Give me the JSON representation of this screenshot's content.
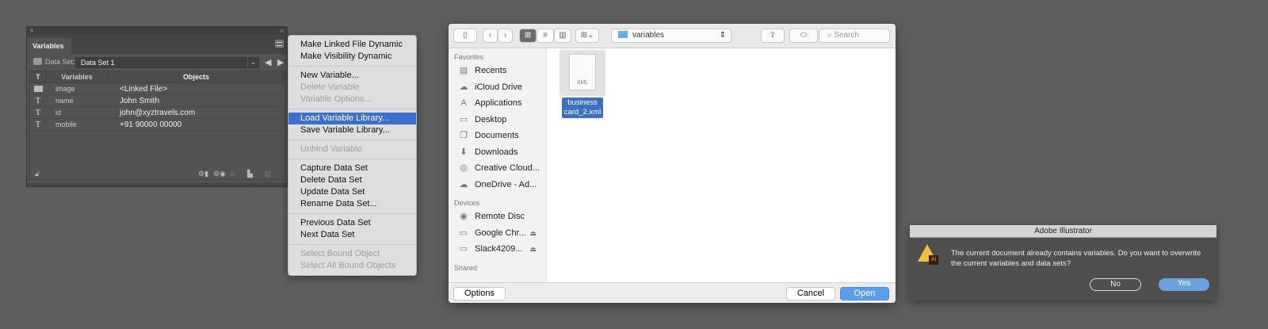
{
  "variables_panel": {
    "close": "×",
    "collapse": "‹‹",
    "tab": "Variables",
    "dataset_label": "Data Set:",
    "dataset_value": "Data Set 1",
    "columns": [
      "T",
      "Variables",
      "Objects"
    ],
    "rows": [
      {
        "type": "image",
        "name": "image",
        "value": "<Linked File>"
      },
      {
        "type": "T",
        "name": "name",
        "value": "John Smith"
      },
      {
        "type": "T",
        "name": "id",
        "value": "john@xyztravels.com"
      },
      {
        "type": "T",
        "name": "mobile",
        "value": "+91 90000 00000"
      }
    ]
  },
  "context_menu": {
    "items": [
      {
        "label": "Make Linked File Dynamic"
      },
      {
        "label": "Make Visibility Dynamic"
      },
      {
        "label": "New Variable..."
      },
      {
        "label": "Delete Variable",
        "disabled": true
      },
      {
        "label": "Variable Options...",
        "disabled": true
      },
      {
        "label": "Load Variable Library...",
        "highlighted": true
      },
      {
        "label": "Save Variable Library..."
      },
      {
        "label": "Unbind Variable",
        "disabled": true
      },
      {
        "label": "Capture Data Set"
      },
      {
        "label": "Delete Data Set"
      },
      {
        "label": "Update Data Set"
      },
      {
        "label": "Rename Data Set..."
      },
      {
        "label": "Previous Data Set"
      },
      {
        "label": "Next Data Set"
      },
      {
        "label": "Select Bound Object",
        "disabled": true
      },
      {
        "label": "Select All Bound Objects",
        "disabled": true
      }
    ]
  },
  "finder": {
    "location": "variables",
    "search_placeholder": "Search",
    "favorites_header": "Favorites",
    "favorites": [
      "Recents",
      "iCloud Drive",
      "Applications",
      "Desktop",
      "Documents",
      "Downloads",
      "Creative Cloud...",
      "OneDrive - Ad..."
    ],
    "devices_header": "Devices",
    "devices": [
      "Remote Disc",
      "Google Chr...",
      "Slack4209..."
    ],
    "shared_header": "Shared",
    "file": {
      "name": "business card_2.xml",
      "icon_label": "XML"
    },
    "options": "Options",
    "cancel": "Cancel",
    "open": "Open"
  },
  "alert": {
    "title": "Adobe Illustrator",
    "message": "The current document already contains variables. Do you want to overwrite the current variables and data sets?",
    "icon_label": "Ai",
    "no": "No",
    "yes": "Yes"
  },
  "colors": {
    "highlight": "#3b6fd0",
    "yes": "#6aa2de"
  }
}
